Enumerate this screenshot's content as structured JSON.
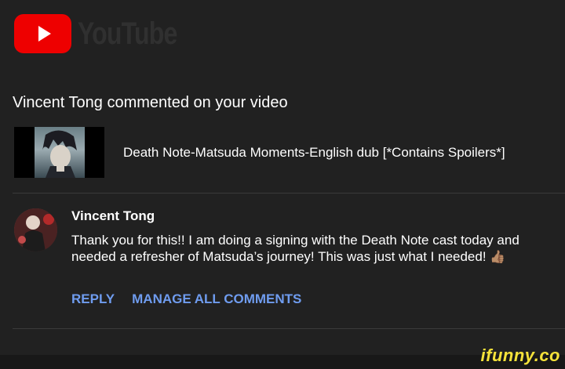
{
  "header": {
    "logo_text": "YouTube",
    "logo_icon": "play-icon",
    "brand_color": "#ee0000"
  },
  "notification": {
    "headline": "Vincent Tong commented on your video"
  },
  "video": {
    "title": "Death Note-Matsuda Moments-English dub [*Contains Spoilers*]"
  },
  "comment": {
    "author": "Vincent Tong",
    "text": "Thank you for this!! I am doing a signing with the Death Note cast today and needed a refresher of Matsuda’s journey! This was just what I needed!",
    "emoji": "👍🏽"
  },
  "actions": {
    "reply_label": "REPLY",
    "manage_label": "MANAGE ALL COMMENTS",
    "link_color": "#6f9cef"
  },
  "watermark": {
    "text": "ifunny.co"
  }
}
